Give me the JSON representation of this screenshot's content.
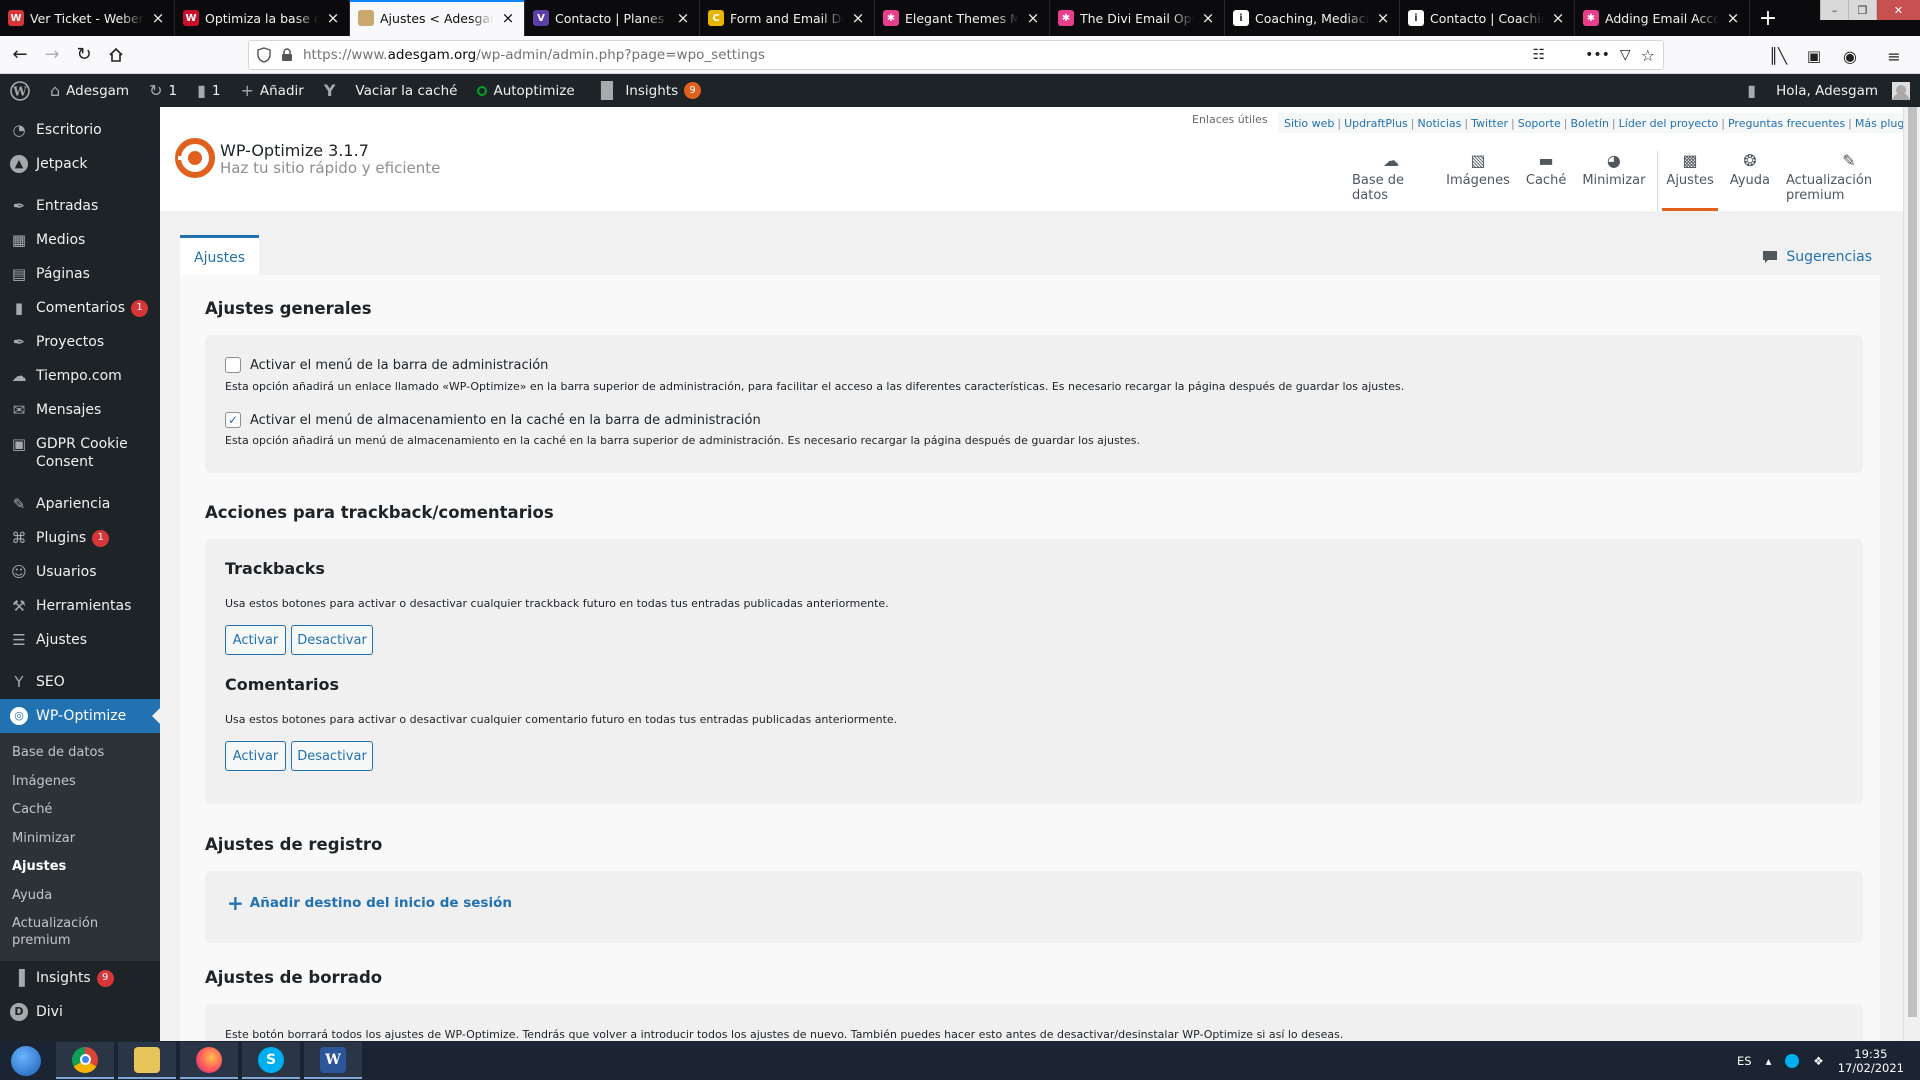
{
  "browser": {
    "tabs": [
      {
        "title": "Ver Ticket - Webempresa",
        "fav": "W",
        "fav_color": "#d63638"
      },
      {
        "title": "Optimiza la base de datos",
        "fav": "W",
        "fav_color": "#c8102e"
      },
      {
        "title": "Ajustes < Adesgam — WordPress",
        "fav": "",
        "fav_color": "#c9a96e",
        "active": true
      },
      {
        "title": "Contacto | Planes de pensiones",
        "fav": "V",
        "fav_color": "#5b3fa6"
      },
      {
        "title": "Form and Email Designer",
        "fav": "C",
        "fav_color": "#e7b600"
      },
      {
        "title": "Elegant Themes Members Area",
        "fav": "✱",
        "fav_color": "#e83e8c"
      },
      {
        "title": "The Divi Email Optin Module",
        "fav": "✱",
        "fav_color": "#e83e8c"
      },
      {
        "title": "Coaching, Mediación y Formación",
        "fav": "i",
        "fav_color": "#ffffff"
      },
      {
        "title": "Contacto | Coaching, Mediación",
        "fav": "i",
        "fav_color": "#ffffff"
      },
      {
        "title": "Adding Email Accounts",
        "fav": "✱",
        "fav_color": "#e83e8c"
      }
    ],
    "url_prefix": "https://www.",
    "url_domain": "adesgam.org",
    "url_path": "/wp-admin/admin.php?page=wpo_settings"
  },
  "adminbar": {
    "site": "Adesgam",
    "updates": "1",
    "comments": "1",
    "add_new": "Añadir",
    "purge_cache": "Vaciar la caché",
    "autoptimize": "Autoptimize",
    "insights": "Insights",
    "insights_count": "9",
    "greeting": "Hola, Adesgam"
  },
  "sidebar": {
    "items": [
      {
        "label": "Escritorio",
        "icon": "dashboard-icon"
      },
      {
        "label": "Jetpack",
        "icon": "jetpack-icon"
      },
      {
        "label": "Entradas",
        "icon": "pin-icon"
      },
      {
        "label": "Medios",
        "icon": "media-icon"
      },
      {
        "label": "Páginas",
        "icon": "page-icon"
      },
      {
        "label": "Comentarios",
        "icon": "comment-icon",
        "badge": "1"
      },
      {
        "label": "Proyectos",
        "icon": "pin-icon"
      },
      {
        "label": "Tiempo.com",
        "icon": "weather-icon"
      },
      {
        "label": "Mensajes",
        "icon": "messages-icon"
      },
      {
        "label": "GDPR Cookie Consent",
        "icon": "lock-icon"
      },
      {
        "label": "Apariencia",
        "icon": "brush-icon"
      },
      {
        "label": "Plugins",
        "icon": "plugin-icon",
        "badge": "1"
      },
      {
        "label": "Usuarios",
        "icon": "user-icon"
      },
      {
        "label": "Herramientas",
        "icon": "wrench-icon"
      },
      {
        "label": "Ajustes",
        "icon": "settings-icon"
      },
      {
        "label": "SEO",
        "icon": "yoast-icon"
      },
      {
        "label": "WP-Optimize",
        "icon": "wpo-icon"
      },
      {
        "label": "Insights",
        "icon": "chart-icon",
        "badge": "9"
      },
      {
        "label": "Divi",
        "icon": "divi-icon"
      }
    ],
    "submenu": [
      "Base de datos",
      "Imágenes",
      "Caché",
      "Minimizar",
      "Ajustes",
      "Ayuda",
      "Actualización premium"
    ]
  },
  "wpo": {
    "product": "WP-Optimize 3.1.7",
    "tagline": "Haz tu sitio rápido y eficiente",
    "useful_links_label": "Enlaces útiles",
    "links": [
      "Sitio web",
      "UpdraftPlus",
      "Noticias",
      "Twitter",
      "Soporte",
      "Boletín",
      "Líder del proyecto",
      "Preguntas frecuentes",
      "Más plugins"
    ],
    "nav": [
      {
        "label": "Base de datos",
        "icon": "cloud-icon"
      },
      {
        "label": "Imágenes",
        "icon": "images-icon"
      },
      {
        "label": "Caché",
        "icon": "archive-icon"
      },
      {
        "label": "Minimizar",
        "icon": "gauge-icon"
      },
      {
        "label": "Ajustes",
        "icon": "settings-icon",
        "active": true
      },
      {
        "label": "Ayuda",
        "icon": "lifebuoy-icon"
      },
      {
        "label": "Actualización premium",
        "icon": "plugin-icon"
      }
    ],
    "page_tab": "Ajustes",
    "suggestions": "Sugerencias"
  },
  "general": {
    "title": "Ajustes generales",
    "opt1_label": "Activar el menú de la barra de administración",
    "opt1_checked": false,
    "opt1_help": "Esta opción añadirá un enlace llamado «WP-Optimize» en la barra superior de administración, para facilitar el acceso a las diferentes características. Es necesario recargar la página después de guardar los ajustes.",
    "opt2_label": "Activar el menú de almacenamiento en la caché en la barra de administración",
    "opt2_checked": true,
    "opt2_help": "Esta opción añadirá un menú de almacenamiento en la caché en la barra superior de administración. Es necesario recargar la página después de guardar los ajustes."
  },
  "trackback": {
    "title": "Acciones para trackback/comentarios",
    "trackbacks_title": "Trackbacks",
    "trackbacks_help": "Usa estos botones para activar o desactivar cualquier trackback futuro en todas tus entradas publicadas anteriormente.",
    "comments_title": "Comentarios",
    "comments_help": "Usa estos botones para activar o desactivar cualquier comentario futuro en todas tus entradas publicadas anteriormente.",
    "enable": "Activar",
    "disable": "Desactivar"
  },
  "logging": {
    "title": "Ajustes de registro",
    "add_destination": "Añadir destino del inicio de sesión"
  },
  "erase": {
    "title": "Ajustes de borrado",
    "help": "Este botón borrará todos los ajustes de WP-Optimize. Tendrás que volver a introducir todos los ajustes de nuevo. También puedes hacer esto antes de desactivar/desinstalar WP-Optimize si así lo deseas."
  },
  "taskbar": {
    "lang": "ES",
    "time": "19:35",
    "date": "17/02/2021"
  },
  "colors": {
    "accent": "#2271b1",
    "wpo_orange": "#e0601e",
    "admin_dark": "#1d2327"
  }
}
